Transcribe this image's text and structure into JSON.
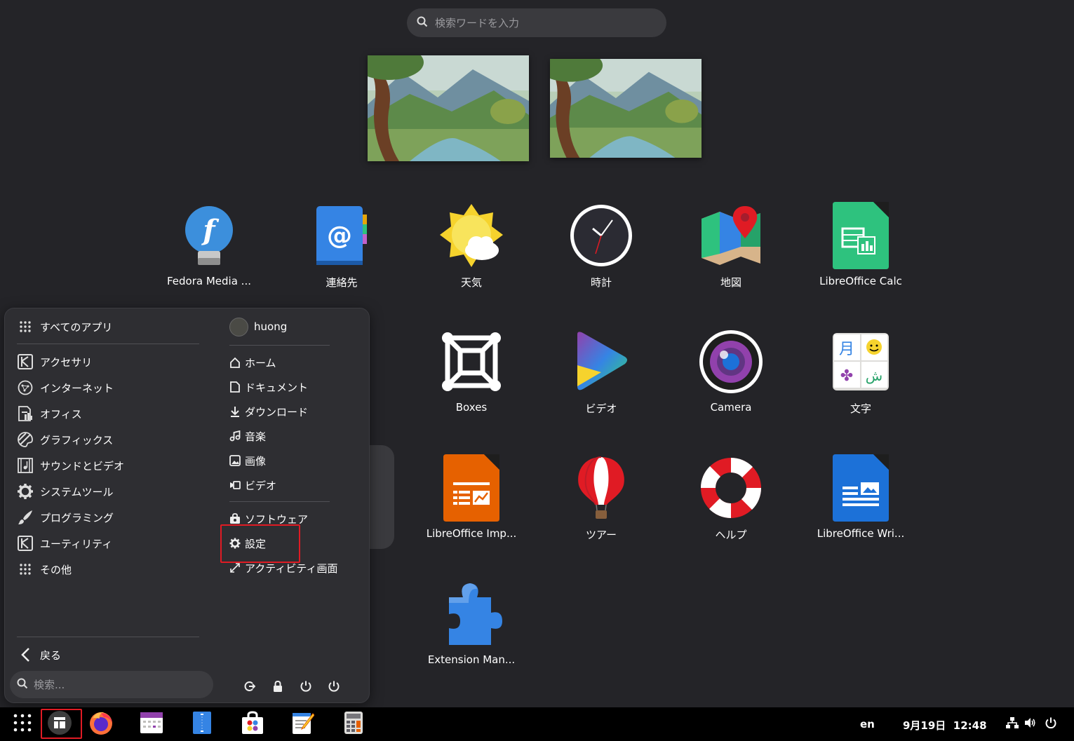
{
  "search": {
    "placeholder": "検索ワードを入力"
  },
  "apps": [
    {
      "label": "Fedora Media ...",
      "icon": "fedora-media-writer-icon"
    },
    {
      "label": "連絡先",
      "icon": "contacts-icon"
    },
    {
      "label": "天気",
      "icon": "weather-icon"
    },
    {
      "label": "時計",
      "icon": "clock-icon"
    },
    {
      "label": "地図",
      "icon": "maps-icon"
    },
    {
      "label": "LibreOffice Calc",
      "icon": "libreoffice-calc-icon"
    },
    {
      "label": "Boxes",
      "icon": "boxes-icon"
    },
    {
      "label": "ビデオ",
      "icon": "video-icon"
    },
    {
      "label": "Camera",
      "icon": "camera-icon"
    },
    {
      "label": "文字",
      "icon": "characters-icon"
    },
    {
      "label": "LibreOffice Imp...",
      "icon": "libreoffice-impress-icon"
    },
    {
      "label": "ツアー",
      "icon": "tour-icon"
    },
    {
      "label": "ヘルプ",
      "icon": "help-icon"
    },
    {
      "label": "LibreOffice Wri...",
      "icon": "libreoffice-writer-icon"
    },
    {
      "label": "Extension Man...",
      "icon": "extension-manager-icon"
    }
  ],
  "menu": {
    "all_apps": "すべてのアプリ",
    "categories": [
      {
        "label": "アクセサリ",
        "icon": "accessories-icon"
      },
      {
        "label": "インターネット",
        "icon": "internet-icon"
      },
      {
        "label": "オフィス",
        "icon": "office-icon"
      },
      {
        "label": "グラフィックス",
        "icon": "graphics-icon"
      },
      {
        "label": "サウンドとビデオ",
        "icon": "sound-video-icon"
      },
      {
        "label": "システムツール",
        "icon": "system-tools-icon"
      },
      {
        "label": "プログラミング",
        "icon": "programming-icon"
      },
      {
        "label": "ユーティリティ",
        "icon": "utilities-icon"
      },
      {
        "label": "その他",
        "icon": "other-icon"
      }
    ],
    "back": "戻る",
    "search_placeholder": "検索...",
    "user": "huong",
    "places": [
      {
        "label": "ホーム",
        "icon": "home-icon"
      },
      {
        "label": "ドキュメント",
        "icon": "document-icon"
      },
      {
        "label": "ダウンロード",
        "icon": "download-icon"
      },
      {
        "label": "音楽",
        "icon": "music-icon"
      },
      {
        "label": "画像",
        "icon": "image-icon"
      },
      {
        "label": "ビデオ",
        "icon": "video-folder-icon"
      }
    ],
    "system": [
      {
        "label": "ソフトウェア",
        "icon": "software-icon"
      },
      {
        "label": "設定",
        "icon": "settings-gear-icon"
      },
      {
        "label": "アクティビティ画面",
        "icon": "activities-icon"
      }
    ]
  },
  "taskbar": {
    "lang": "en",
    "datetime": "9月19日  12:48"
  },
  "colors": {
    "accent_highlight": "#e01b24",
    "background": "#242428",
    "menu_bg": "#2e2e32"
  }
}
